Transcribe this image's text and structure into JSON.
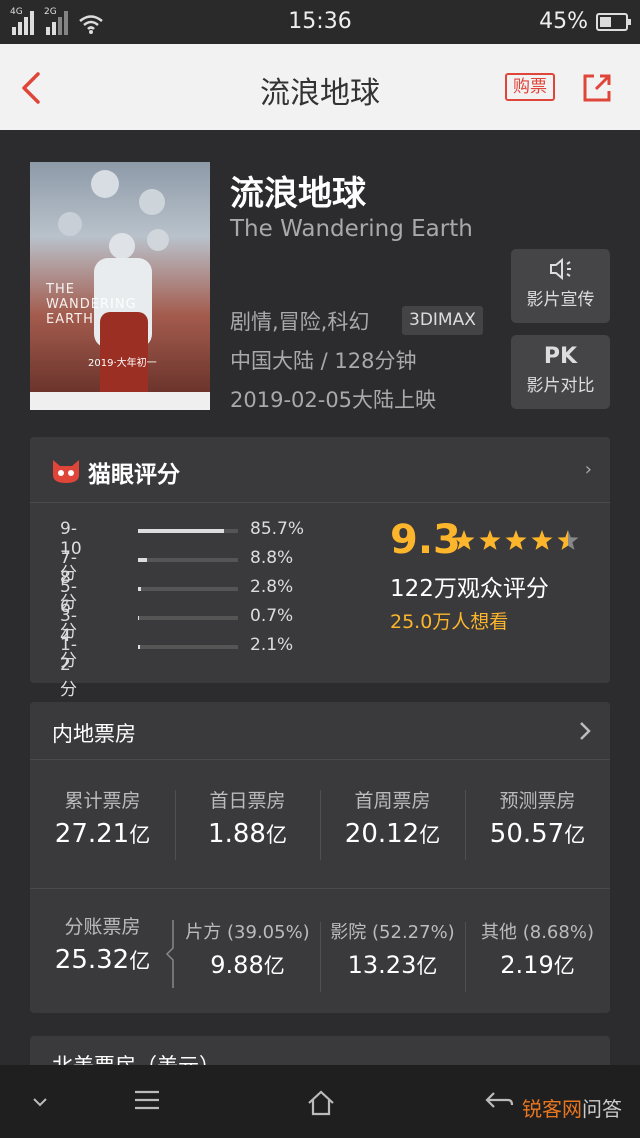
{
  "status_bar": {
    "net1": "4G",
    "net2": "2G",
    "time": "15:36",
    "battery": "45%",
    "battery_level": 0.45
  },
  "header": {
    "title": "流浪地球",
    "buy_label": "购票"
  },
  "movie": {
    "title": "流浪地球",
    "english_title": "The Wandering Earth",
    "genre": "剧情,冒险,科幻",
    "format": "3DIMAX",
    "region_duration": "中国大陆 / 128分钟",
    "release": "2019-02-05大陆上映",
    "poster_text": "THE WANDERING EARTH",
    "poster_date": "2019·大年初一"
  },
  "side_buttons": [
    {
      "icon": "speaker-icon",
      "label": "影片宣传"
    },
    {
      "icon_text": "PK",
      "label": "影片对比"
    }
  ],
  "rating": {
    "title": "猫眼评分",
    "distribution": [
      {
        "label": "9-10分",
        "percent": "85.7%",
        "value": 85.7
      },
      {
        "label": "7-8分",
        "percent": "8.8%",
        "value": 8.8
      },
      {
        "label": "5-6分",
        "percent": "2.8%",
        "value": 2.8
      },
      {
        "label": "3-4分",
        "percent": "0.7%",
        "value": 0.7
      },
      {
        "label": "1-2分",
        "percent": "2.1%",
        "value": 2.1
      }
    ],
    "score": "9.3",
    "stars": 4.5,
    "voters": "122万观众评分",
    "want": "25.0万人想看",
    "accent_color": "#fdb62b"
  },
  "box_office": {
    "title": "内地票房",
    "top": [
      {
        "key": "累计票房",
        "value": "27.21",
        "unit": "亿"
      },
      {
        "key": "首日票房",
        "value": "1.88",
        "unit": "亿"
      },
      {
        "key": "首周票房",
        "value": "20.12",
        "unit": "亿"
      },
      {
        "key": "预测票房",
        "value": "50.57",
        "unit": "亿"
      }
    ],
    "split": {
      "key": "分账票房",
      "value": "25.32",
      "unit": "亿"
    },
    "split_parts": [
      {
        "key": "片方 (39.05%)",
        "value": "9.88",
        "unit": "亿"
      },
      {
        "key": "影院 (52.27%)",
        "value": "13.23",
        "unit": "亿"
      },
      {
        "key": "其他 (8.68%)",
        "value": "2.19",
        "unit": "亿"
      }
    ]
  },
  "north_america": {
    "title": "北美票房（美元）"
  },
  "watermark": {
    "orange": "锐客网",
    "gray": "问答"
  },
  "brand_color": "#e0453a"
}
